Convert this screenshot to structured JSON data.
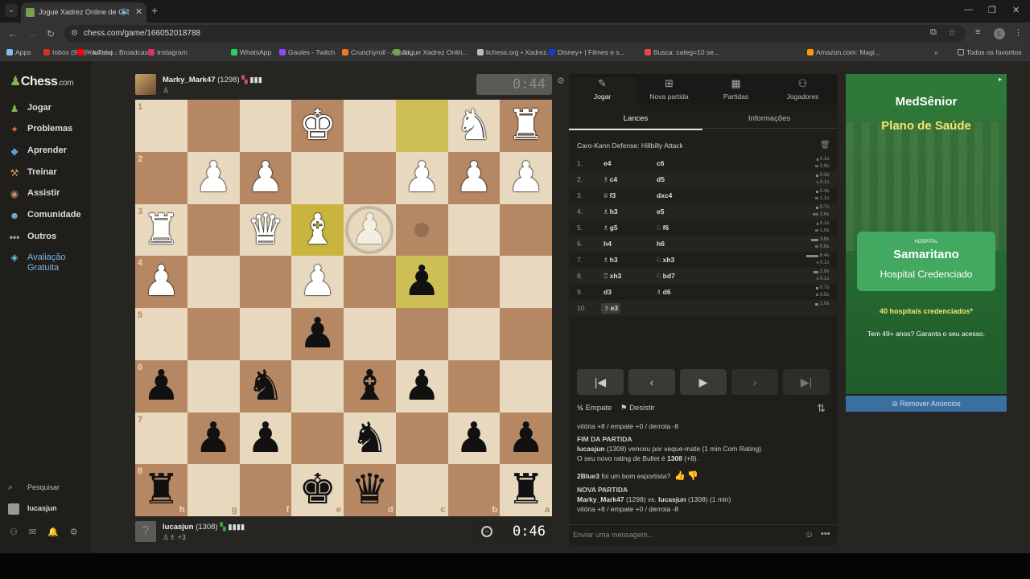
{
  "browser": {
    "tab_title": "Jogue Xadrez Online de GR",
    "url": "chess.com/game/166052018788",
    "bookmarks": [
      {
        "label": "Apps",
        "color": "#8ab4f8"
      },
      {
        "label": "Inbox (943) - lucas.j...",
        "color": "#d93025"
      },
      {
        "label": "YouTube - Broadcas...",
        "color": "#ff0000"
      },
      {
        "label": "Instagram",
        "color": "#e1306c"
      },
      {
        "label": "WhatsApp",
        "color": "#25d366"
      },
      {
        "label": "Gaules - Twitch",
        "color": "#9146ff"
      },
      {
        "label": "Crunchyroll - Assist...",
        "color": "#f47521"
      },
      {
        "label": "Jogue Xadrez Onlin...",
        "color": "#76a04b"
      },
      {
        "label": "lichess.org • Xadrez...",
        "color": "#bbbbbb"
      },
      {
        "label": "Disney+ | Filmes e s...",
        "color": "#113ccf"
      },
      {
        "label": "Busca: categ=10 se...",
        "color": "#e44"
      },
      {
        "label": "Amazon.com: Magi...",
        "color": "#ff9900"
      }
    ],
    "all_favorites": "Todos os favoritos"
  },
  "sidebar": {
    "logo": "Chess",
    "logo_suffix": ".com",
    "items": [
      {
        "label": "Jogar",
        "icon": "♟"
      },
      {
        "label": "Problemas",
        "icon": "✦"
      },
      {
        "label": "Aprender",
        "icon": "◆"
      },
      {
        "label": "Treinar",
        "icon": "⚒"
      },
      {
        "label": "Assistir",
        "icon": "◉"
      },
      {
        "label": "Comunidade",
        "icon": "☻"
      },
      {
        "label": "Outros",
        "icon": "•••"
      },
      {
        "label": "Avaliação Gratuita",
        "icon": "◈"
      }
    ],
    "search": "Pesquisar",
    "user": "lucasjun"
  },
  "top_player": {
    "name": "Marky_Mark47",
    "rating": "(1298)",
    "clock": "0:44"
  },
  "bottom_player": {
    "name": "lucasjun",
    "rating": "(1308)",
    "captured": "♙♗ +3",
    "clock": "0:46"
  },
  "board": {
    "rank_labels": [
      "1",
      "2",
      "3",
      "4",
      "5",
      "6",
      "7",
      "8"
    ],
    "file_labels": [
      "h",
      "g",
      "f",
      "e",
      "d",
      "c",
      "b",
      "a"
    ],
    "pieces": [
      [
        null,
        null,
        null,
        "wK",
        null,
        null,
        "wN",
        "wR"
      ],
      [
        null,
        "wP",
        "wP",
        null,
        null,
        "wP",
        "wP",
        "wP"
      ],
      [
        "wR",
        null,
        "wQ",
        "wB",
        "wP*",
        null,
        null,
        null
      ],
      [
        "wP",
        null,
        null,
        "wP",
        null,
        "bP",
        null,
        null
      ],
      [
        null,
        null,
        null,
        "bP",
        null,
        null,
        null,
        null
      ],
      [
        "bP",
        null,
        "bN",
        null,
        "bB",
        "bP",
        null,
        null
      ],
      [
        null,
        "bP",
        "bP",
        null,
        "bN",
        null,
        "bP",
        "bP"
      ],
      [
        "bR",
        null,
        null,
        "bK",
        "bQ",
        null,
        null,
        "bR"
      ]
    ],
    "highlighted": [
      [
        0,
        5
      ],
      [
        3,
        5
      ]
    ],
    "highlighted_bishop": [
      2,
      3
    ],
    "hint_dot": [
      2,
      5
    ],
    "ring": [
      2,
      4
    ]
  },
  "panel": {
    "tabs": [
      {
        "label": "Jogar",
        "icon": "✎"
      },
      {
        "label": "Nova partida",
        "icon": "⊞"
      },
      {
        "label": "Partidas",
        "icon": "▦"
      },
      {
        "label": "Jogadores",
        "icon": "⚇"
      }
    ],
    "subtabs": [
      "Lances",
      "Informações"
    ],
    "opening": "Caro-Kann Defense: Hillbilly Attack",
    "moves": [
      {
        "n": "1.",
        "wp": "",
        "w": "e4",
        "bp": "",
        "b": "c6",
        "wt": "0.1s",
        "bt": "0.9s"
      },
      {
        "n": "2.",
        "wp": "♗",
        "w": "c4",
        "bp": "",
        "b": "d5",
        "wt": "0.3s",
        "bt": "0.1s"
      },
      {
        "n": "3.",
        "wp": "♕",
        "w": "f3",
        "bp": "",
        "b": "dxc4",
        "wt": "0.4s",
        "bt": "1.1s"
      },
      {
        "n": "4.",
        "wp": "♗",
        "w": "h3",
        "bp": "",
        "b": "e5",
        "wt": "0.7s",
        "bt": "2.6s"
      },
      {
        "n": "5.",
        "wp": "♗",
        "w": "g5",
        "bp": "♘",
        "b": "f6",
        "wt": "0.1s",
        "bt": "1.0s"
      },
      {
        "n": "6.",
        "wp": "",
        "w": "h4",
        "bp": "",
        "b": "h6",
        "wt": "3.6s",
        "bt": "0.8s"
      },
      {
        "n": "7.",
        "wp": "♗",
        "w": "h3",
        "bp": "♘",
        "b": "xh3",
        "wt": "6.4s",
        "bt": "0.1s"
      },
      {
        "n": "8.",
        "wp": "♖",
        "w": "xh3",
        "bp": "♘",
        "b": "bd7",
        "wt": "1.8s",
        "bt": "0.1s"
      },
      {
        "n": "9.",
        "wp": "",
        "w": "d3",
        "bp": "♗",
        "b": "d6",
        "wt": "0.7s",
        "bt": "0.5s"
      },
      {
        "n": "10.",
        "wp": "♗",
        "w": "e3",
        "bp": "",
        "b": "",
        "wt": "1.0s",
        "bt": ""
      }
    ],
    "draw": "Empate",
    "resign": "Desistir",
    "chat": {
      "line0": "vitória +8 / empate +0 / derrota -8",
      "end_header": "FIM DA PARTIDA",
      "end_user": "lucasjun",
      "end_text": " (1308) venceu por xeque-mate (1 min Com Rating)",
      "rating_prefix": "O seu novo rating de Bullet é ",
      "rating_value": "1308",
      "rating_delta": " (+8).",
      "sport_user": "2Blue3",
      "sport_text": " foi um bom esportista?",
      "new_header": "NOVA PARTIDA",
      "new_p1": "Marky_Mark47",
      "new_mid": " (1298) vs. ",
      "new_p2": "lucasjun",
      "new_end": " (1308) (1 min)",
      "line_last": "vitória +8 / empate +0 / derrota -8"
    },
    "chat_placeholder": "Enviar uma mensagem..."
  },
  "ad": {
    "brand": "MedSênior",
    "title": "Plano de Saúde",
    "card_small": "HOSPITAL",
    "card_name": "Samaritano",
    "card_sub": "Hospital Credenciado",
    "line1": "40 hospitais credenciados*",
    "line2": "Tem 49+ anos? Garanta o seu acesso.",
    "remove": "Remover Anúncios"
  }
}
